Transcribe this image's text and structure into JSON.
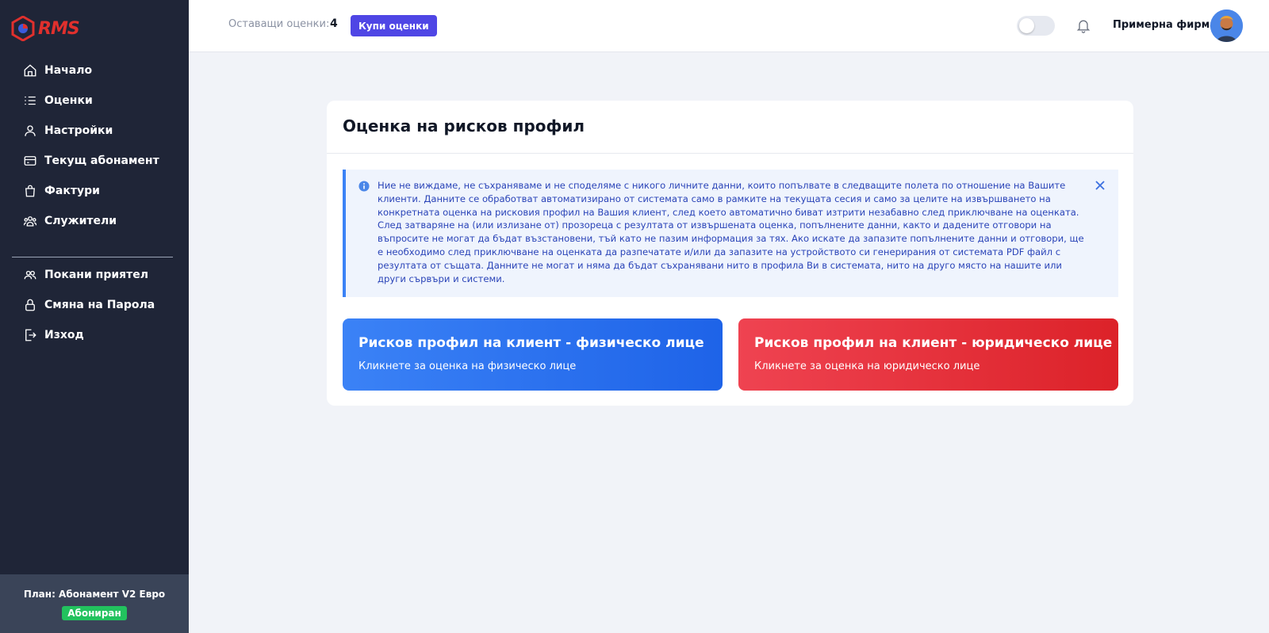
{
  "brand": {
    "logo_text": "RMS",
    "accent": "#e0302d"
  },
  "sidebar": {
    "items": [
      {
        "label": "Начало",
        "icon": "home-icon"
      },
      {
        "label": "Оценки",
        "icon": "list-icon"
      },
      {
        "label": "Настройки",
        "icon": "user-icon"
      },
      {
        "label": "Текущ абонамент",
        "icon": "card-icon"
      },
      {
        "label": "Фактури",
        "icon": "bag-icon"
      },
      {
        "label": "Служители",
        "icon": "users-icon"
      }
    ],
    "secondary_items": [
      {
        "label": "Покани приятел",
        "icon": "invite-icon"
      },
      {
        "label": "Смяна на Парола",
        "icon": "lock-icon"
      },
      {
        "label": "Изход",
        "icon": "logout-icon"
      }
    ],
    "plan": {
      "text": "План: Абонамент V2 Евро",
      "badge": "Абониран",
      "badge_color": "#22c25e"
    }
  },
  "header": {
    "remaining_label": "Оставащи оценки:",
    "remaining_count": "4",
    "buy_button": "Купи оценки",
    "company_name": "Примерна фирма"
  },
  "main": {
    "title": "Оценка на рисков профил",
    "info_text": "Ние не виждаме, не съхраняваме и не споделяме с никого личните данни, които попълвате в следващите полета по отношение на Вашите клиенти. Данните се обработват автоматизирано от системата само в рамките на текущата сесия и само за целите на извършването на конкретната оценка на рисковия профил на Вашия клиент, след което автоматично биват изтрити незабавно след приключване на оценката. След затваряне на (или излизане от) прозореца с резултата от извършената оценка, попълнените данни, както и дадените отговори на въпросите не могат да бъдат възстановени, тъй като не пазим информация за тях. Ако искате да запазите попълнените данни и отговори, ще е необходимо след приключване на оценката да разпечатате и/или да запазите на устройството си генерирания от системата PDF файл с резултата от същата. Данните не могат и няма да бъдат съхранявани нито в профила Ви в системата, нито на друго място на нашите или други сървъри и системи.",
    "tiles": [
      {
        "title": "Рисков профил на клиент - физическо лице",
        "subtitle": "Кликнете за оценка на физическо лице",
        "color": "#2f74f0"
      },
      {
        "title": "Рисков профил на клиент - юридическо лице",
        "subtitle": "Кликнете за оценка на юридическо лице",
        "color": "#e5303a"
      }
    ]
  }
}
